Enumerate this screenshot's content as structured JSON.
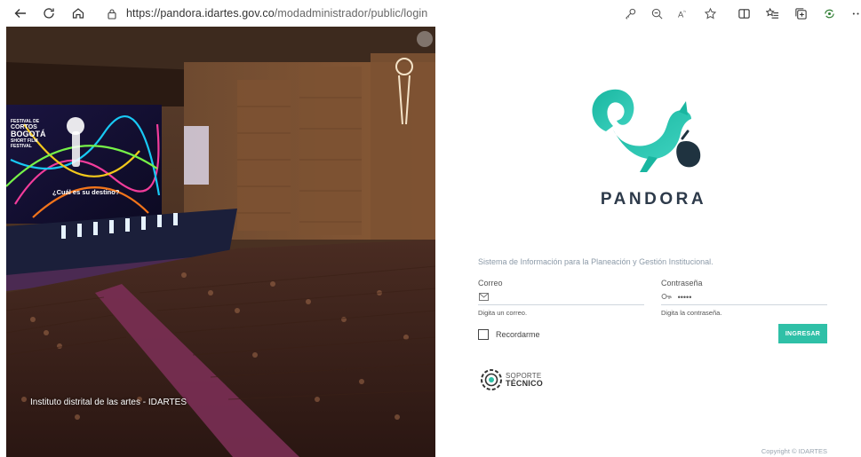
{
  "browser": {
    "url_host": "https://pandora.idartes.gov.co",
    "url_path": "/modadministrador/public/login",
    "nav_icons": [
      "back-icon",
      "refresh-icon",
      "home-icon"
    ],
    "toolbar_icons": [
      "key-icon",
      "zoom-icon",
      "read-aloud-icon",
      "favorite-star-icon",
      "split-screen-icon",
      "favorites-list-icon",
      "collections-icon",
      "extensions-icon",
      "more-icon"
    ]
  },
  "photo": {
    "caption": "Instituto distrital de las artes - IDARTES",
    "screen_text_1": "FESTIVAL DE",
    "screen_text_2": "CORTOS",
    "screen_text_3": "BOGOTÁ",
    "screen_text_4": "SHORT FILM",
    "screen_text_5": "FESTIVAL",
    "screen_tagline": "¿Cuál es su destino?"
  },
  "login": {
    "brand": "PANDORA",
    "subtitle": "Sistema de Información para la Planeación y Gestión Institucional.",
    "email_label": "Correo",
    "email_value": "",
    "email_hint": "Digita un correo.",
    "password_label": "Contraseña",
    "password_value": "•••••",
    "password_hint": "Digita la contraseña.",
    "remember_label": "Recordarme",
    "submit_label": "INGRESAR",
    "support_line1": "SOPORTE",
    "support_line2": "TÉCNICO",
    "copyright": "Copyright © IDARTES"
  },
  "colors": {
    "accent": "#2fc0a7",
    "brand_text": "#2d3a4a",
    "logo_gradient_start": "#19b6a0",
    "logo_gradient_end": "#3fd3c0"
  }
}
